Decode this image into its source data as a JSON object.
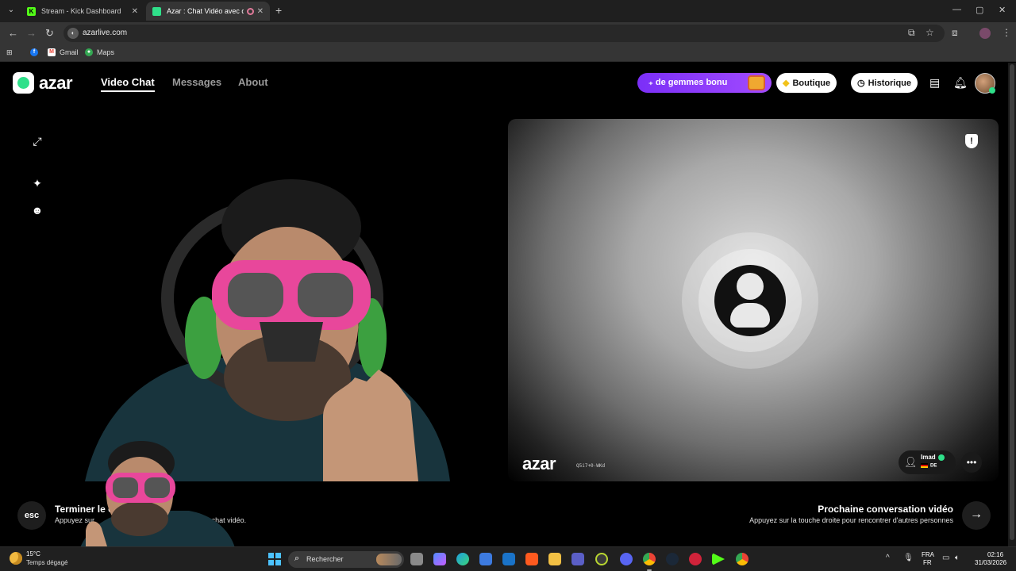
{
  "browser": {
    "tabs": [
      {
        "title": "Stream - Kick Dashboard",
        "favicon": "kick-icon",
        "color": "#53fc18"
      },
      {
        "title": "Azar : Chat Vidéo avec de n",
        "favicon": "azar-icon",
        "color": "#2fe08a",
        "active": true
      }
    ],
    "url": "azarlive.com",
    "bookmarks": [
      {
        "label": "Gmail",
        "icon": "gmail-icon"
      },
      {
        "label": "Maps",
        "icon": "maps-icon"
      }
    ]
  },
  "site": {
    "logo": "azar",
    "nav": [
      {
        "label": "Video Chat",
        "active": true
      },
      {
        "label": "Messages"
      },
      {
        "label": "About"
      }
    ],
    "promo": "₊ de gemmes bonu",
    "shop": "Boutique",
    "history": "Historique",
    "right_video": {
      "logo": "azar",
      "session_id": "Q5i7+0-WKd",
      "peer_name": "Imad",
      "peer_country": "DE"
    },
    "end": {
      "key": "esc",
      "title": "Terminer le c",
      "subtitle": "Appuyez sur",
      "subtitle_end": "u chat vidéo."
    },
    "next": {
      "title": "Prochaine conversation vidéo",
      "subtitle": "Appuyez sur la touche droite pour rencontrer d'autres personnes"
    }
  },
  "taskbar": {
    "temp": "15°C",
    "weather": "Temps dégagé",
    "search_placeholder": "Rechercher",
    "lang_top": "FRA",
    "lang_bottom": "FR",
    "time": "02:16",
    "date": "31/03/2026"
  },
  "colors": {
    "accent_green": "#2fe08a",
    "promo_purple": "#8b3cf9",
    "windows_blue": "#4cc2ff"
  }
}
